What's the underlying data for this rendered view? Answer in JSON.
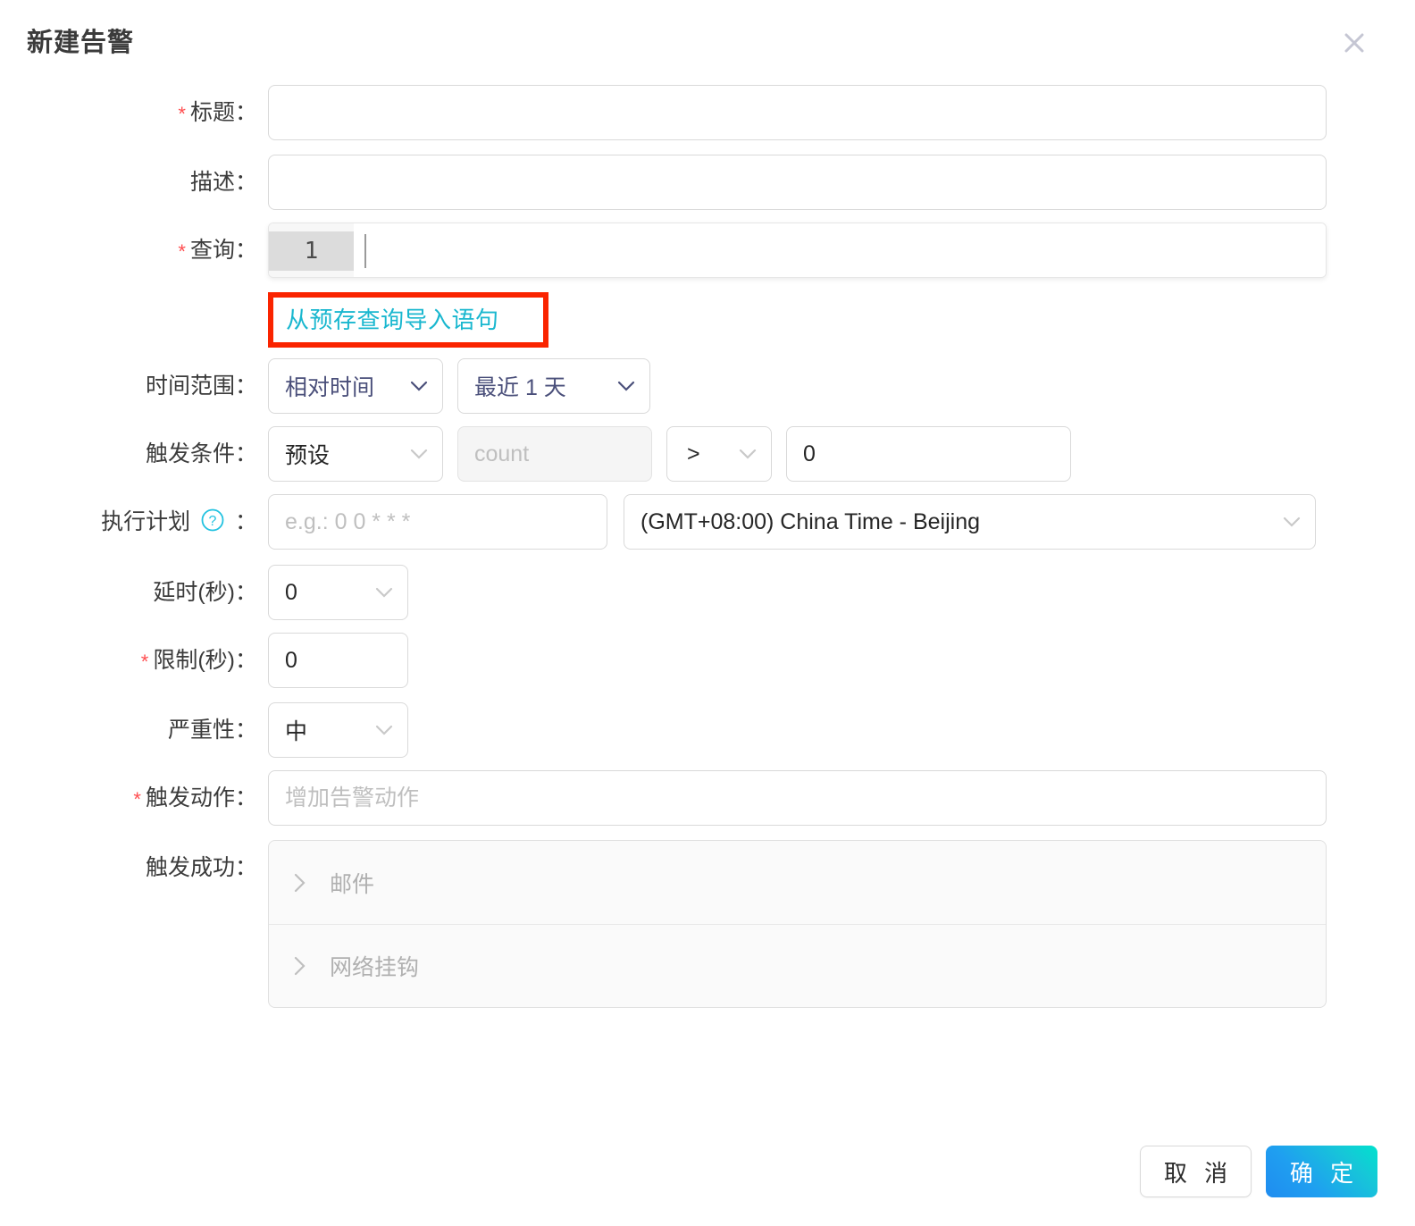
{
  "dialog": {
    "title": "新建告警",
    "close_icon": "close-icon"
  },
  "fields": {
    "title": {
      "label": "标题：",
      "required": true,
      "value": "",
      "placeholder": ""
    },
    "description": {
      "label": "描述：",
      "required": false,
      "value": "",
      "placeholder": ""
    },
    "query": {
      "label": "查询：",
      "required": true,
      "line_number": "1",
      "value": ""
    },
    "import_link": {
      "text": "从预存查询导入语句",
      "highlight_color": "#fa2400",
      "link_color": "#19b7cf"
    },
    "time_range": {
      "label": "时间范围：",
      "mode": "相对时间",
      "range": "最近 1 天"
    },
    "trigger_condition": {
      "label": "触发条件：",
      "mode": "预设",
      "metric_placeholder": "count",
      "operator": ">",
      "threshold": "0"
    },
    "schedule": {
      "label": "执行计划",
      "label_suffix": "：",
      "help_icon": "question-circle-icon",
      "cron_placeholder": "e.g.: 0 0 * * *",
      "cron_value": "",
      "timezone": "(GMT+08:00) China Time - Beijing"
    },
    "delay": {
      "label": "延时(秒)：",
      "value": "0"
    },
    "limit": {
      "label": "限制(秒)：",
      "required": true,
      "value": "0"
    },
    "severity": {
      "label": "严重性：",
      "value": "中"
    },
    "trigger_action": {
      "label": "触发动作：",
      "required": true,
      "placeholder": "增加告警动作",
      "value": ""
    },
    "trigger_success": {
      "label": "触发成功：",
      "items": [
        {
          "label": "邮件",
          "expanded": false
        },
        {
          "label": "网络挂钩",
          "expanded": false
        }
      ]
    }
  },
  "footer": {
    "cancel_label": "取 消",
    "confirm_label": "确 定",
    "confirm_gradient_from": "#1f8cf0",
    "confirm_gradient_to": "#00e2cd"
  }
}
